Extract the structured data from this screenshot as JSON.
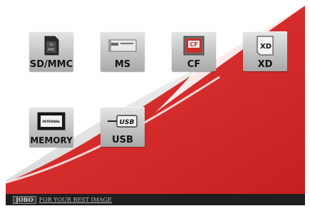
{
  "tiles": [
    {
      "label": "SD/MMC",
      "icon": "sd-card-icon"
    },
    {
      "label": "MS",
      "icon": "memory-stick-icon"
    },
    {
      "label": "CF",
      "icon": "compact-flash-icon"
    },
    {
      "label": "XD",
      "icon": "xd-card-icon"
    },
    {
      "label": "MEMORY",
      "icon": "internal-memory-icon"
    },
    {
      "label": "USB",
      "icon": "usb-icon"
    }
  ],
  "icon_text": {
    "sd": "SD",
    "mmc": "MMC",
    "cf": "CF",
    "xd": "XD",
    "internal": "INTERNAL",
    "usb": "USB"
  },
  "footer": {
    "brand": "JOBO",
    "tagline": "FOR YOUR BEST IMAGE"
  },
  "colors": {
    "accent_red": "#d42a2a",
    "tile_gray": "#c4c4c4",
    "footer_bg": "#1f1f1f"
  }
}
